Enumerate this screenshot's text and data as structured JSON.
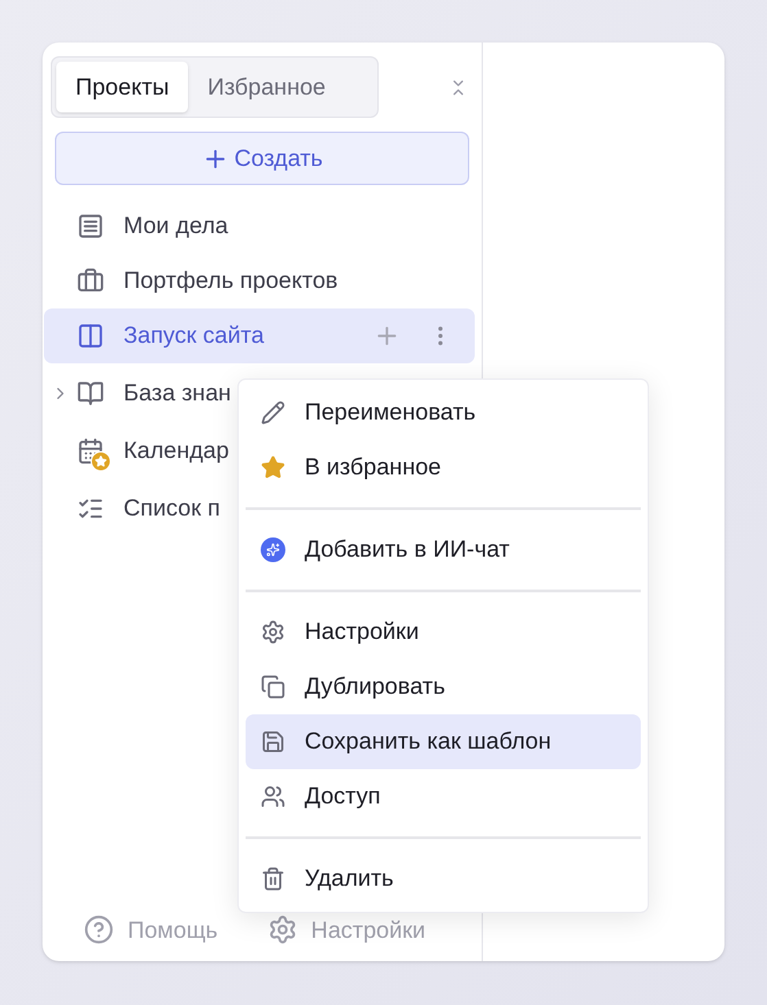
{
  "tabs": [
    {
      "label": "Проекты",
      "selected": true
    },
    {
      "label": "Избранное",
      "selected": false
    }
  ],
  "create_button": {
    "label": "Создать"
  },
  "sidebar": {
    "items": [
      {
        "label": "Мои дела",
        "selected": false,
        "expandable": false,
        "starred": false
      },
      {
        "label": "Портфель проектов",
        "selected": false,
        "expandable": false,
        "starred": false
      },
      {
        "label": "Запуск сайта",
        "selected": true,
        "expandable": false,
        "starred": false
      },
      {
        "label": "База знан",
        "selected": false,
        "expandable": true,
        "starred": false
      },
      {
        "label": "Календар",
        "selected": false,
        "expandable": false,
        "starred": true
      },
      {
        "label": "Список п",
        "selected": false,
        "expandable": false,
        "starred": false
      }
    ]
  },
  "context_menu": {
    "items": [
      {
        "kind": "item",
        "label": "Переименовать",
        "selected": false
      },
      {
        "kind": "item",
        "label": "В избранное",
        "selected": false
      },
      {
        "kind": "divider"
      },
      {
        "kind": "item",
        "label": "Добавить в ИИ-чат",
        "selected": false
      },
      {
        "kind": "divider"
      },
      {
        "kind": "item",
        "label": "Настройки",
        "selected": false
      },
      {
        "kind": "item",
        "label": "Дублировать",
        "selected": false
      },
      {
        "kind": "item",
        "label": "Сохранить как шаблон",
        "selected": true
      },
      {
        "kind": "item",
        "label": "Доступ",
        "selected": false
      },
      {
        "kind": "divider"
      },
      {
        "kind": "item",
        "label": "Удалить",
        "selected": false
      }
    ]
  },
  "footer": {
    "help": "Помощь",
    "settings": "Настройки"
  }
}
